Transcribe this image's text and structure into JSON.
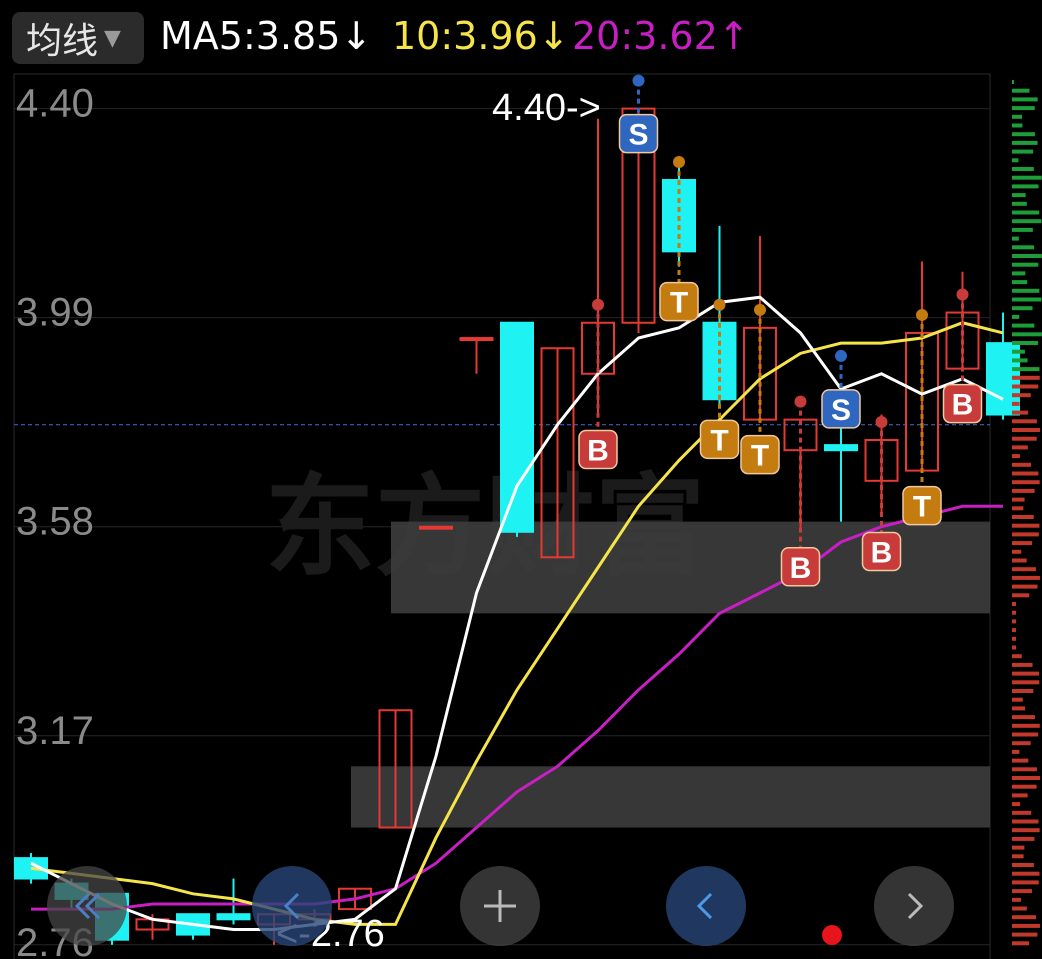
{
  "header": {
    "indicator_label": "均线",
    "indicator_caret": "▼",
    "ma5_text": "MA5:3.85↓",
    "ma10_text": "10:3.96↓",
    "ma20_text": "20:3.62↑"
  },
  "colors": {
    "ma5": "#ffffff",
    "ma10": "#f5e54b",
    "ma20": "#c71fc4",
    "up": "#e53935",
    "down": "#1ef2f2",
    "bg": "#000000"
  },
  "watermark": "东方财富",
  "chart_data": {
    "type": "candlestick",
    "y_ticks": [
      {
        "label": "4.40",
        "value": 4.4
      },
      {
        "label": "3.99",
        "value": 3.99
      },
      {
        "label": "3.58",
        "value": 3.58
      },
      {
        "label": "3.17",
        "value": 3.17
      },
      {
        "label": "2.76",
        "value": 2.76
      }
    ],
    "ylim": [
      2.74,
      4.46
    ],
    "max_annotation": "4.40->",
    "min_annotation": "<-2.76",
    "current_price": 3.78,
    "candles": [
      {
        "o": 2.93,
        "h": 2.94,
        "l": 2.88,
        "c": 2.89
      },
      {
        "o": 2.88,
        "h": 2.89,
        "l": 2.83,
        "c": 2.85
      },
      {
        "o": 2.86,
        "h": 2.86,
        "l": 2.76,
        "c": 2.77
      },
      {
        "o": 2.79,
        "h": 2.82,
        "l": 2.77,
        "c": 2.81
      },
      {
        "o": 2.82,
        "h": 2.82,
        "l": 2.77,
        "c": 2.78
      },
      {
        "o": 2.82,
        "h": 2.89,
        "l": 2.8,
        "c": 2.81
      },
      {
        "o": 2.8,
        "h": 2.82,
        "l": 2.76,
        "c": 2.82
      },
      {
        "o": 2.81,
        "h": 2.83,
        "l": 2.8,
        "c": 2.82
      },
      {
        "o": 2.83,
        "h": 2.87,
        "l": 2.83,
        "c": 2.87
      },
      {
        "o": 2.99,
        "h": 3.22,
        "l": 2.99,
        "c": 3.22
      },
      {
        "o": 3.58,
        "h": 3.58,
        "l": 3.58,
        "c": 3.58
      },
      {
        "o": 3.95,
        "h": 3.95,
        "l": 3.88,
        "c": 3.95
      },
      {
        "o": 3.98,
        "h": 3.98,
        "l": 3.56,
        "c": 3.57
      },
      {
        "o": 3.52,
        "h": 3.93,
        "l": 3.52,
        "c": 3.93
      },
      {
        "o": 3.88,
        "h": 4.38,
        "l": 3.8,
        "c": 3.98
      },
      {
        "o": 3.98,
        "h": 4.4,
        "l": 3.96,
        "c": 4.4
      },
      {
        "o": 4.26,
        "h": 4.29,
        "l": 4.09,
        "c": 4.12
      },
      {
        "o": 3.98,
        "h": 4.17,
        "l": 3.82,
        "c": 3.83
      },
      {
        "o": 3.79,
        "h": 4.15,
        "l": 3.79,
        "c": 3.97
      },
      {
        "o": 3.73,
        "h": 3.73,
        "l": 3.57,
        "c": 3.79
      },
      {
        "o": 3.74,
        "h": 3.86,
        "l": 3.59,
        "c": 3.73
      },
      {
        "o": 3.67,
        "h": 3.8,
        "l": 3.6,
        "c": 3.75
      },
      {
        "o": 3.69,
        "h": 4.1,
        "l": 3.69,
        "c": 3.96
      },
      {
        "o": 3.89,
        "h": 4.08,
        "l": 3.89,
        "c": 4.0
      },
      {
        "o": 3.94,
        "h": 4.0,
        "l": 3.79,
        "c": 3.8
      }
    ],
    "ma5": [
      2.92,
      null,
      2.84,
      2.81,
      2.8,
      2.79,
      2.79,
      2.8,
      2.81,
      2.87,
      3.13,
      3.45,
      3.66,
      3.78,
      3.88,
      3.95,
      3.97,
      4.02,
      4.03,
      3.96,
      3.85,
      3.88,
      3.84,
      3.87,
      3.83
    ],
    "ma10": [
      2.91,
      2.9,
      2.89,
      2.88,
      2.86,
      2.85,
      2.83,
      2.81,
      2.8,
      2.8,
      2.97,
      3.12,
      3.26,
      3.38,
      3.5,
      3.62,
      3.71,
      3.79,
      3.87,
      3.92,
      3.94,
      3.94,
      3.95,
      3.98,
      3.96
    ],
    "ma20": [
      2.83,
      2.83,
      2.83,
      2.84,
      2.84,
      2.84,
      2.84,
      2.84,
      2.85,
      2.87,
      2.92,
      2.99,
      3.06,
      3.11,
      3.18,
      3.26,
      3.33,
      3.41,
      3.45,
      3.49,
      3.55,
      3.58,
      3.6,
      3.62,
      3.62
    ],
    "signals": [
      {
        "i": 14,
        "type": "B"
      },
      {
        "i": 15,
        "type": "S"
      },
      {
        "i": 16,
        "type": "T"
      },
      {
        "i": 17,
        "type": "T"
      },
      {
        "i": 18,
        "type": "T"
      },
      {
        "i": 19,
        "type": "B"
      },
      {
        "i": 20,
        "type": "S"
      },
      {
        "i": 21,
        "type": "B"
      },
      {
        "i": 22,
        "type": "T"
      },
      {
        "i": 23,
        "type": "B"
      }
    ],
    "price_zones": [
      {
        "low": 3.41,
        "high": 3.59
      },
      {
        "low": 2.99,
        "high": 3.11
      }
    ]
  },
  "nav": {
    "back_icon": "double-chevron-left-icon",
    "zoom_icon": "plus-icon",
    "prev_icon": "chevron-left-icon",
    "next_icon": "chevron-right-icon"
  }
}
